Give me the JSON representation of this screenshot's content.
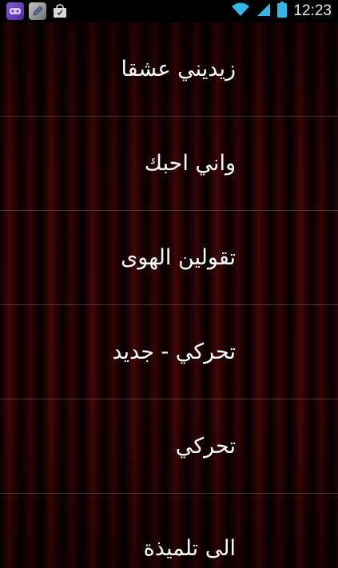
{
  "status_bar": {
    "time": "12:23",
    "notification_icons": [
      "game-app-icon",
      "pencil-app-icon",
      "shopping-bag-icon"
    ],
    "system_icons": [
      "wifi-icon",
      "signal-icon",
      "battery-icon"
    ]
  },
  "list": {
    "items": [
      {
        "label": "زيديني عشقا"
      },
      {
        "label": "واني احبك"
      },
      {
        "label": "تقولين الهوى"
      },
      {
        "label": "تحركي - جديد"
      },
      {
        "label": "تحركي"
      },
      {
        "label": "الى تلميذة"
      }
    ]
  },
  "colors": {
    "background_curtain": "#3c0506",
    "text": "#ffffff",
    "status_bar": "#000000",
    "wifi_accent": "#33b5e5"
  }
}
